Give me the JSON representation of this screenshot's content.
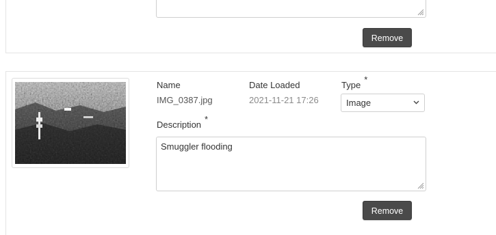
{
  "attachments": [
    {
      "description_value": "",
      "remove_label": "Remove"
    },
    {
      "thumbnail_icon": "image-thumbnail",
      "name_label": "Name",
      "name_value": "IMG_0387.jpg",
      "date_label": "Date Loaded",
      "date_value": "2021-11-21 17:26",
      "type_label": "Type",
      "type_required": "*",
      "type_value": "Image",
      "description_label": "Description",
      "description_required": "*",
      "description_value": "Smuggler flooding",
      "remove_label": "Remove"
    }
  ],
  "colors": {
    "button_bg": "#4a4a4a",
    "date_text": "#888888",
    "border": "#cfcfcf"
  }
}
